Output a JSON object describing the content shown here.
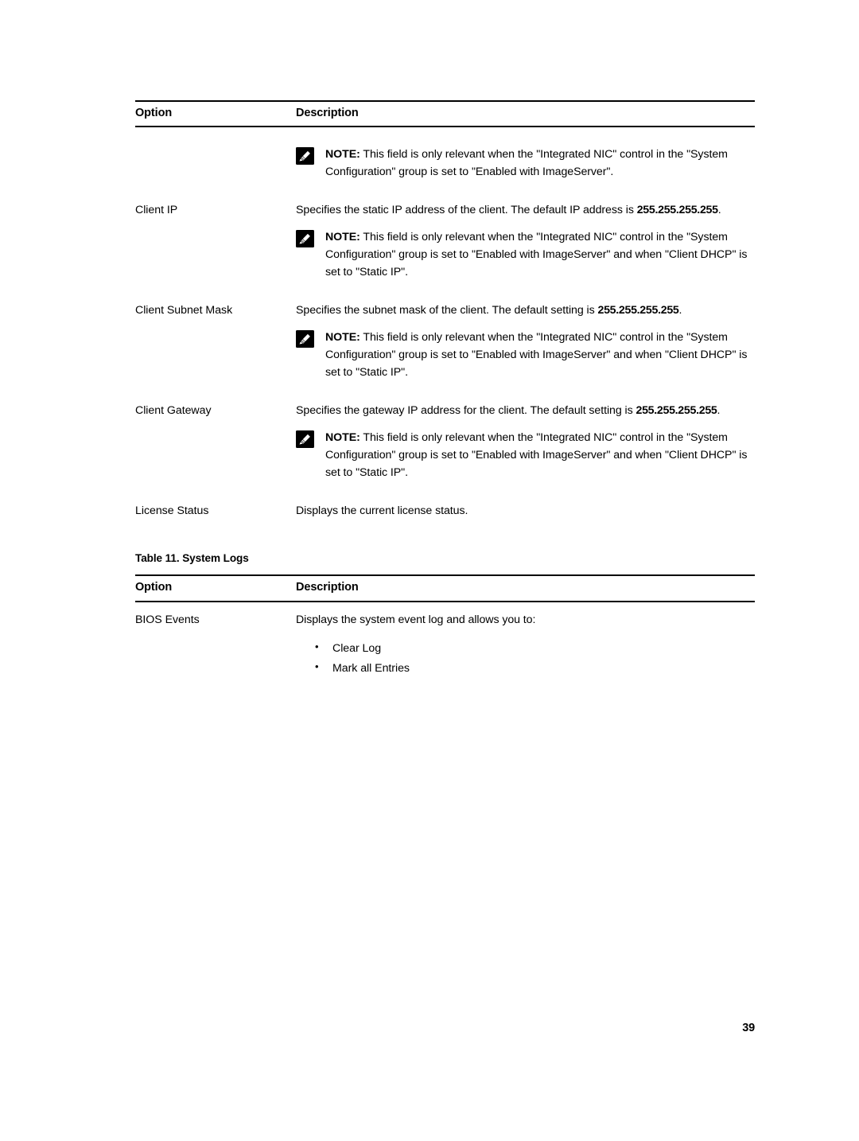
{
  "document": {
    "page_number": "39",
    "ink_color": "#000000",
    "background_color": "#ffffff"
  },
  "icons": {
    "note_icon_name": "note-pencil-icon"
  },
  "table_1": {
    "columns": [
      "Option",
      "Description"
    ],
    "rows": [
      {
        "option": "",
        "description": "",
        "note": {
          "label": "NOTE:",
          "text": " This field is only relevant when the \"Integrated NIC\" control in the \"System Configuration\" group is set to \"Enabled with ImageServer\"."
        }
      },
      {
        "option": "Client IP",
        "description_prefix": "Specifies the static IP address of the client. The default IP address is ",
        "description_value": "255.255.255.255",
        "description_suffix": ".",
        "note": {
          "label": "NOTE:",
          "text": " This field is only relevant when the \"Integrated NIC\" control in the \"System Configuration\" group is set to \"Enabled with ImageServer\" and when \"Client DHCP\" is set to \"Static IP\"."
        }
      },
      {
        "option": "Client Subnet Mask",
        "description_prefix": "Specifies the subnet mask of the client. The default setting is ",
        "description_value": "255.255.255.255",
        "description_suffix": ".",
        "note": {
          "label": "NOTE:",
          "text": " This field is only relevant when the \"Integrated NIC\" control in the \"System Configuration\" group is set to \"Enabled with ImageServer\" and when \"Client DHCP\" is set to \"Static IP\"."
        }
      },
      {
        "option": "Client Gateway",
        "description_prefix": "Specifies the gateway IP address for the client. The default setting is ",
        "description_value": "255.255.255.255",
        "description_suffix": ".",
        "note": {
          "label": "NOTE:",
          "text": " This field is only relevant when the \"Integrated NIC\" control in the \"System Configuration\" group is set to \"Enabled with ImageServer\" and when \"Client DHCP\" is set to \"Static IP\"."
        }
      },
      {
        "option": "License Status",
        "description": "Displays the current license status."
      }
    ]
  },
  "table_2": {
    "caption": "Table 11. System Logs",
    "columns": [
      "Option",
      "Description"
    ],
    "rows": [
      {
        "option": "BIOS Events",
        "description": "Displays the system event log and allows you to:",
        "bullets": [
          "Clear Log",
          "Mark all Entries"
        ]
      }
    ]
  }
}
